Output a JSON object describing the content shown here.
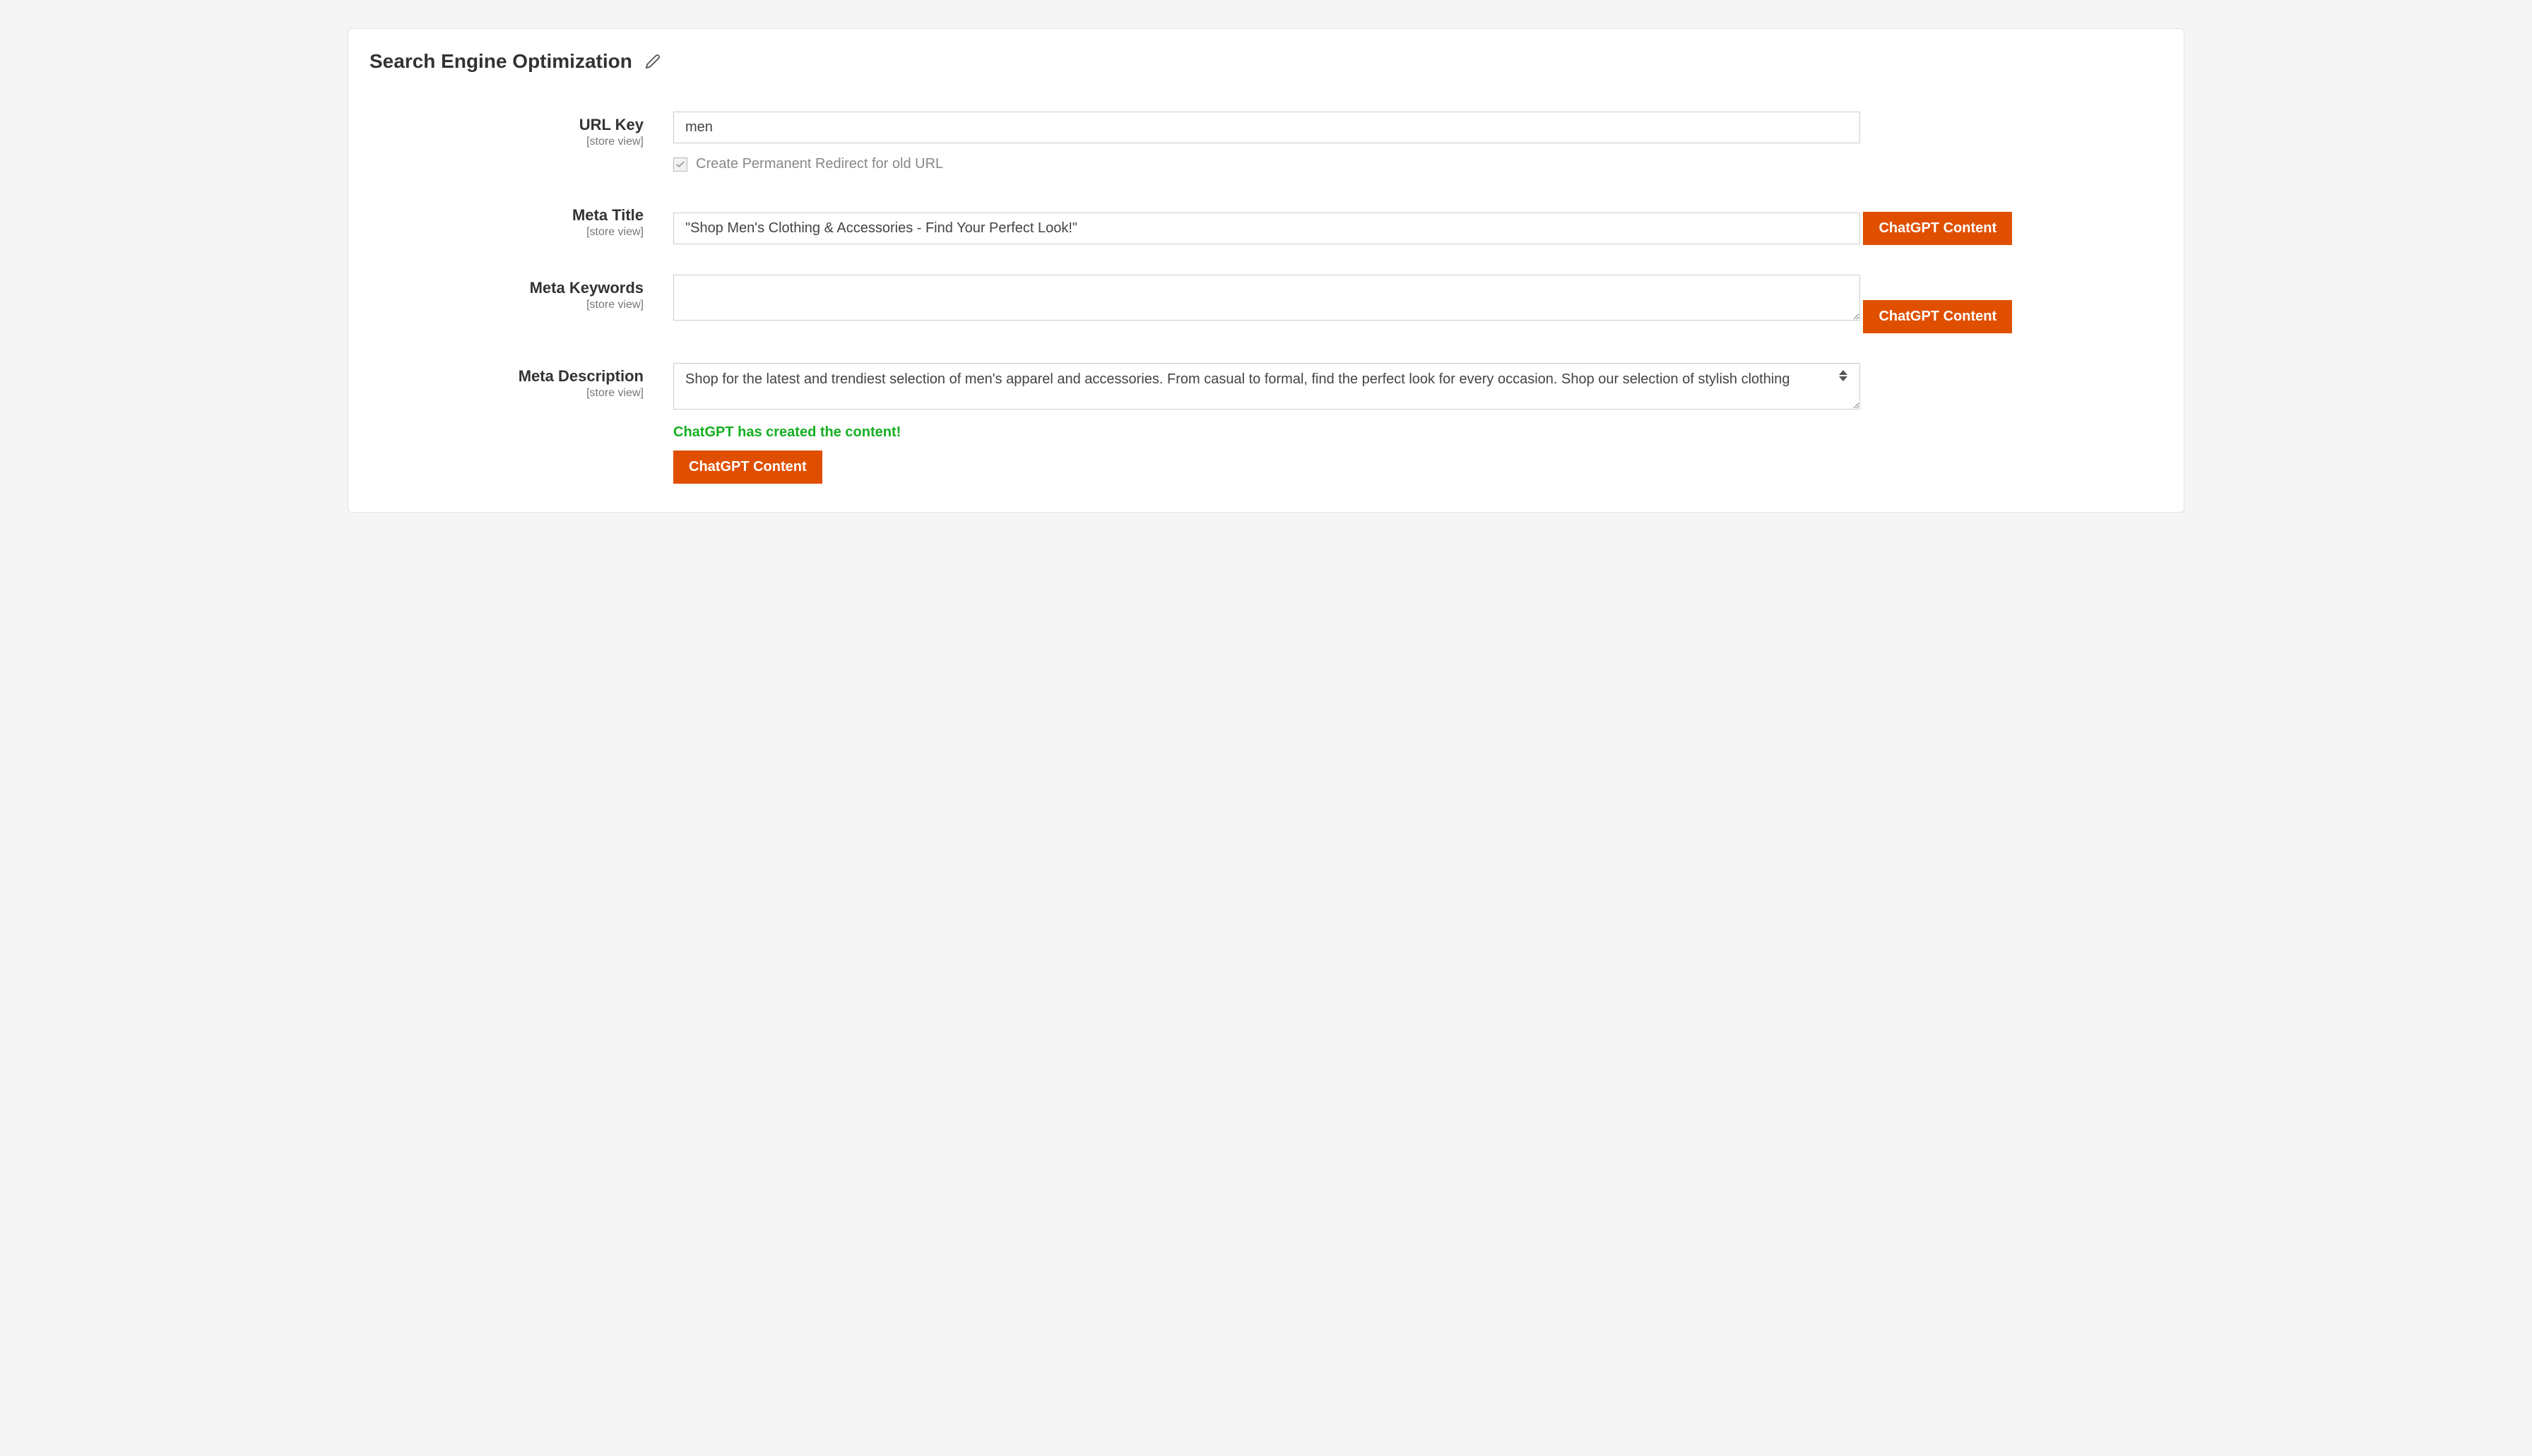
{
  "section": {
    "title": "Search Engine Optimization"
  },
  "fields": {
    "url_key": {
      "label": "URL Key",
      "scope": "[store view]",
      "value": "men",
      "checkbox_label": "Create Permanent Redirect for old URL"
    },
    "meta_title": {
      "label": "Meta Title",
      "scope": "[store view]",
      "value": "\"Shop Men's Clothing & Accessories - Find Your Perfect Look!\"",
      "button_label": "ChatGPT Content"
    },
    "meta_keywords": {
      "label": "Meta Keywords",
      "scope": "[store view]",
      "value": "",
      "button_label": "ChatGPT Content"
    },
    "meta_description": {
      "label": "Meta Description",
      "scope": "[store view]",
      "value": "Shop for the latest and trendiest selection of men's apparel and accessories. From casual to formal, find the perfect look for every occasion. Shop our selection of stylish clothing",
      "success_message": "ChatGPT has created the content!",
      "button_label": "ChatGPT Content"
    }
  }
}
